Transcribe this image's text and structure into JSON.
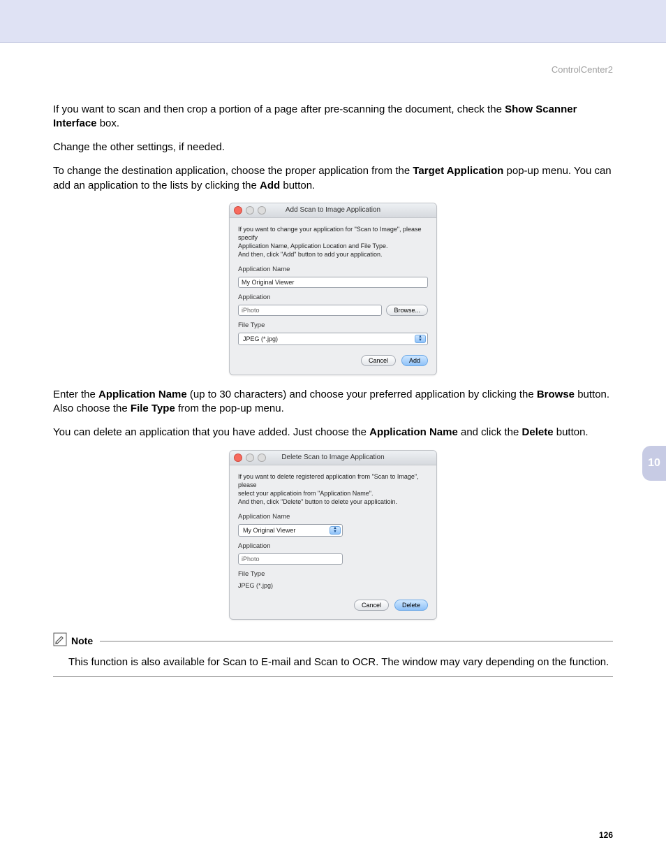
{
  "header": {
    "app_name": "ControlCenter2"
  },
  "section_tab": "10",
  "page_number": "126",
  "text": {
    "p1_a": "If you want to scan and then crop a portion of a page after pre-scanning the document, check the ",
    "p1_b": "Show Scanner Interface",
    "p1_c": " box.",
    "p2": "Change the other settings, if needed.",
    "p3_a": "To change the destination application, choose the proper application from the ",
    "p3_b": "Target Application",
    "p3_c": " pop-up menu. You can add an application to the lists by clicking the ",
    "p3_d": "Add",
    "p3_e": " button.",
    "p4_a": "Enter the ",
    "p4_b": "Application Name",
    "p4_c": " (up to 30 characters) and choose your preferred application by clicking the ",
    "p4_d": "Browse",
    "p4_e": " button. Also choose the ",
    "p4_f": "File Type",
    "p4_g": " from the pop-up menu.",
    "p5_a": "You can delete an application that you have added. Just choose the ",
    "p5_b": "Application Name",
    "p5_c": " and click the ",
    "p5_d": "Delete",
    "p5_e": " button."
  },
  "note": {
    "label": "Note",
    "body": "This function is also available for Scan to E-mail and Scan to OCR. The window may vary depending on the function."
  },
  "add_dialog": {
    "title": "Add Scan to Image Application",
    "desc_l1": "If you want to change your application for \"Scan to Image\", please specify",
    "desc_l2": "Application Name, Application Location and File Type.",
    "desc_l3": "And then, click \"Add\" button to add your application.",
    "app_name_label": "Application Name",
    "app_name_value": "My Original Viewer",
    "app_label": "Application",
    "app_value": "iPhoto",
    "browse_label": "Browse...",
    "filetype_label": "File Type",
    "filetype_value": "JPEG (*.jpg)",
    "cancel_label": "Cancel",
    "primary_label": "Add"
  },
  "delete_dialog": {
    "title": "Delete Scan to Image Application",
    "desc_l1": "If you want to delete registered application from \"Scan to Image\", please",
    "desc_l2": "select your applicatioin from \"Application Name\".",
    "desc_l3": "And then, click \"Delete\" button to delete your applicatioin.",
    "app_name_label": "Application Name",
    "app_name_value": "My Original Viewer",
    "app_label": "Application",
    "app_value": "iPhoto",
    "filetype_label": "File Type",
    "filetype_value": "JPEG (*.jpg)",
    "cancel_label": "Cancel",
    "primary_label": "Delete"
  }
}
